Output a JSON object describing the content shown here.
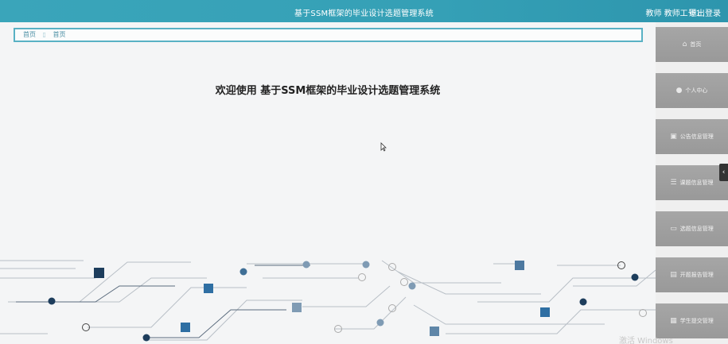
{
  "header": {
    "title": "基于SSM框架的毕业设计选题管理系统",
    "user": "教师 教师工号1",
    "logout": "退出登录"
  },
  "breadcrumb": [
    "首页",
    "首页"
  ],
  "welcome": "欢迎使用 基于SSM框架的毕业设计选题管理系统",
  "menu": [
    {
      "label": "首页",
      "icon": "home-icon"
    },
    {
      "label": "个人中心",
      "icon": "user-icon"
    },
    {
      "label": "公告信息管理",
      "icon": "notice-icon"
    },
    {
      "label": "课题信息管理",
      "icon": "list-icon"
    },
    {
      "label": "选题信息管理",
      "icon": "folder-icon"
    },
    {
      "label": "开题报告管理",
      "icon": "report-icon"
    },
    {
      "label": "学生提交管理",
      "icon": "grid-icon"
    }
  ],
  "watermark": "激活 Windows",
  "colors": {
    "header": "#35a0b6",
    "accent": "#59b1c4",
    "menu": "#a1a1a1"
  }
}
